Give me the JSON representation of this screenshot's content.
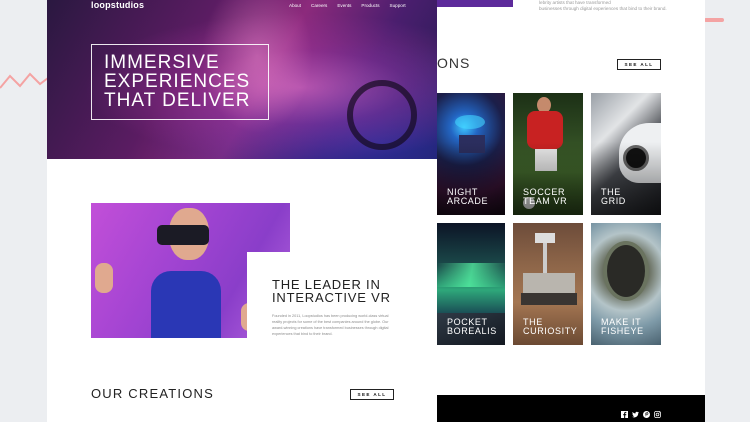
{
  "brand": {
    "logo": "loopstudios"
  },
  "nav": [
    "About",
    "Careers",
    "Events",
    "Products",
    "Support"
  ],
  "hero": {
    "title": "IMMERSIVE\nEXPERIENCES\nTHAT DELIVER"
  },
  "leader": {
    "title": "THE LEADER IN\nINTERACTIVE VR",
    "text": "Founded in 2011, Loopstudios has been producing world-class virtual reality projects for some of the best companies around the globe. Our award-winning creations have transformed businesses through digital experiences that bind to their brand."
  },
  "creations": {
    "title": "OUR CREATIONS",
    "heading_tail": "ONS",
    "see_all": "SEE ALL",
    "items": [
      {
        "label": "NIGHT\nARCADE"
      },
      {
        "label": "SOCCER\nTEAM VR"
      },
      {
        "label": "THE\nGRID"
      },
      {
        "label": "POCKET\nBOREALIS"
      },
      {
        "label": "THE\nCURIOSITY"
      },
      {
        "label": "MAKE IT\nFISHEYE"
      }
    ]
  },
  "back_top_text": {
    "line1": "lebrity artists that have transformed",
    "line2": "businesses through digital experiences that bind to their brand."
  },
  "footer_icons": [
    "facebook-icon",
    "twitter-icon",
    "pinterest-icon",
    "instagram-icon"
  ],
  "colors": {
    "hero_purple": "#8c2a7c",
    "accent_pink": "#f4a3a3",
    "footer": "#000000"
  }
}
